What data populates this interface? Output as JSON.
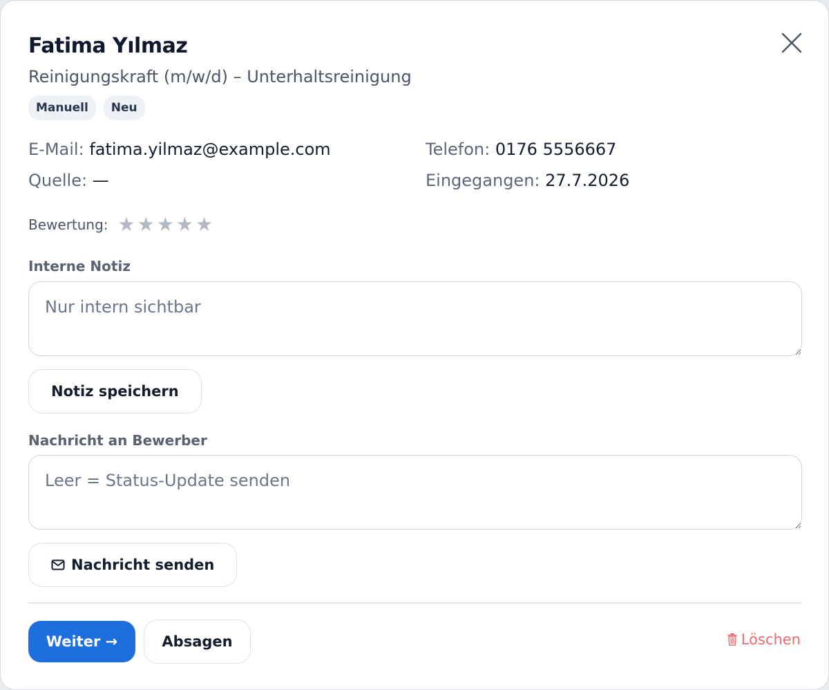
{
  "applicant": {
    "name": "Fatima Yılmaz",
    "position": "Reinigungskraft (m/w/d) – Unterhaltsreinigung",
    "tags": [
      "Manuell",
      "Neu"
    ]
  },
  "details": {
    "email_label": "E-Mail:",
    "email_value": "fatima.yilmaz@example.com",
    "phone_label": "Telefon:",
    "phone_value": "0176 5556667",
    "source_label": "Quelle:",
    "source_value": "—",
    "received_label": "Eingegangen:",
    "received_value": "27.7.2026"
  },
  "rating": {
    "label": "Bewertung:",
    "value": 0,
    "max": 5,
    "star_glyph": "★"
  },
  "note": {
    "label": "Interne Notiz",
    "placeholder": "Nur intern sichtbar",
    "value": "",
    "save_label": "Notiz speichern"
  },
  "message": {
    "label": "Nachricht an Bewerber",
    "placeholder": "Leer = Status-Update senden",
    "value": "",
    "send_label": "Nachricht senden",
    "send_icon": "mail-icon"
  },
  "actions": {
    "next_label": "Weiter →",
    "reject_label": "Absagen",
    "delete_label": "Löschen",
    "delete_icon": "trash-icon"
  },
  "colors": {
    "primary": "#1d6fdd",
    "danger": "#ef6b6b",
    "star_inactive": "#b3b9c4"
  }
}
